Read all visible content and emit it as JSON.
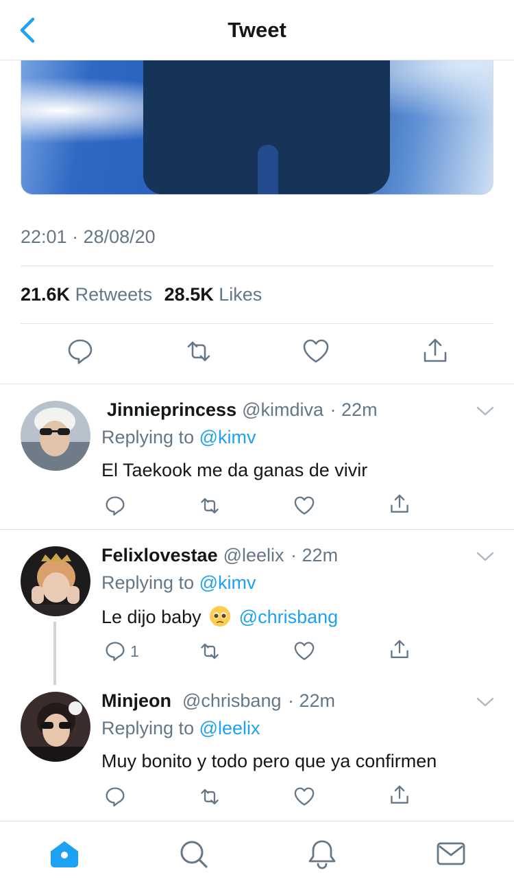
{
  "header": {
    "title": "Tweet",
    "back_icon": "chevron-left-icon"
  },
  "colors": {
    "accent": "#1da1f2",
    "secondary_text": "#657786",
    "primary_text": "#14171a",
    "divider": "#dfe3e6"
  },
  "tweet": {
    "timestamp": "22:01 · 28/08/20",
    "retweets_count": "21.6K",
    "retweets_label": "Retweets",
    "likes_count": "28.5K",
    "likes_label": "Likes",
    "actions": [
      "reply-icon",
      "retweet-icon",
      "like-icon",
      "share-icon"
    ]
  },
  "replies": [
    {
      "name": "Jinnieprincess",
      "handle": "@kimdiva",
      "time": "· 22m",
      "replying_prefix": "Replying to",
      "replying_to": "@kimv",
      "text": "El Taekook me da ganas de vivir",
      "reply_count": ""
    },
    {
      "name": "Felixlovestae",
      "handle": "@leelix",
      "time": "· 22m",
      "replying_prefix": "Replying to",
      "replying_to": "@kimv",
      "text": "Le dijo baby",
      "emoji": "pleading-face-emoji",
      "mention": "@chrisbang",
      "reply_count": "1"
    },
    {
      "name": "Minjeon",
      "handle": "@chrisbang",
      "time": "· 22m",
      "replying_prefix": "Replying to",
      "replying_to": "@leelix",
      "text": "Muy bonito y todo pero que ya confirmen",
      "reply_count": ""
    }
  ],
  "tabbar": {
    "items": [
      "home-icon",
      "search-icon",
      "notifications-icon",
      "messages-icon"
    ],
    "active": "home-icon"
  }
}
